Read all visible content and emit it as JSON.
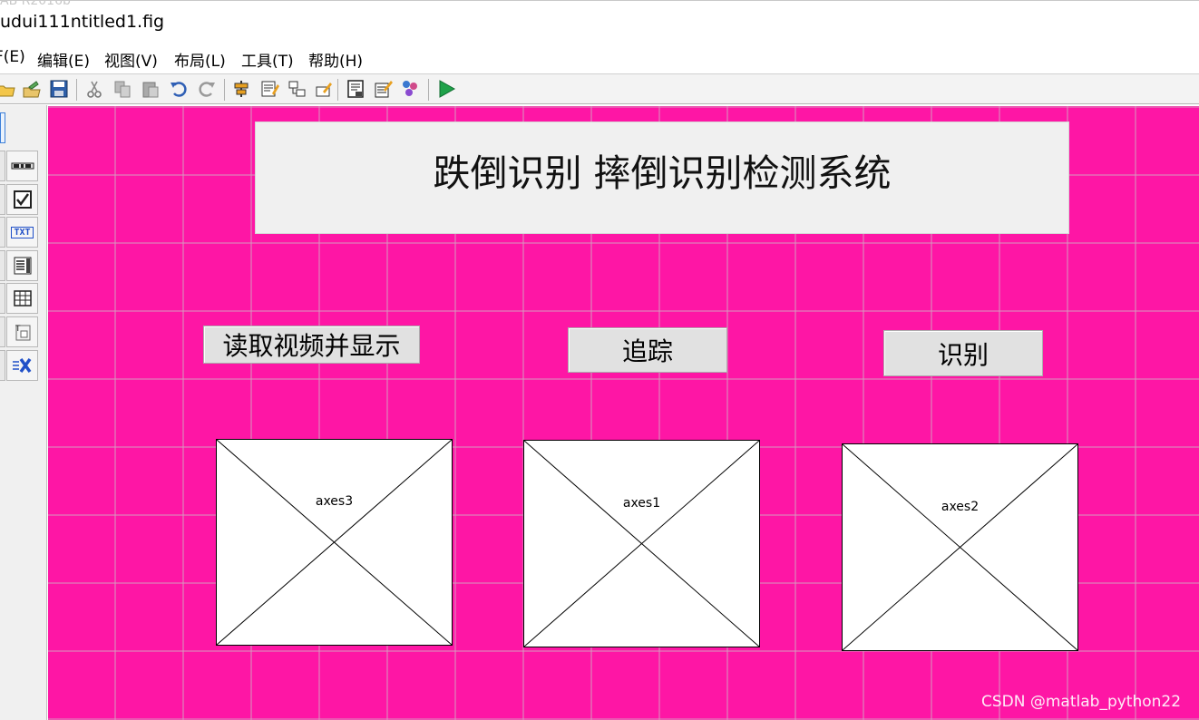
{
  "window": {
    "ghost_title": "AB R2016b",
    "title": "udui111ntitled1.fig"
  },
  "menu": [
    {
      "label": "F(E)"
    },
    {
      "label": "编辑(E)"
    },
    {
      "label": "视图(V)"
    },
    {
      "label": "布局(L)"
    },
    {
      "label": "工具(T)"
    },
    {
      "label": "帮助(H)"
    }
  ],
  "toolbar": {
    "icons": [
      "open-icon",
      "browse-icon",
      "save-icon",
      "cut-icon",
      "copy-icon",
      "paste-icon",
      "undo-icon",
      "redo-icon",
      "align-icon",
      "menu-editor-icon",
      "tab-order-icon",
      "toolbar-editor-icon",
      "editor-icon",
      "property-inspector-icon",
      "object-browser-icon",
      "run-icon"
    ]
  },
  "palette": {
    "items": [
      "pushbutton-icon",
      "slider-icon",
      "checkbox-icon",
      "edit-text-icon",
      "listbox-icon",
      "table-icon",
      "panel-icon",
      "activex-icon"
    ],
    "txt_label": "TXT"
  },
  "canvas": {
    "background": "#fe16a5",
    "title_text": "跌倒识别 摔倒识别检测系统",
    "buttons": {
      "read_video": "读取视频并显示",
      "track": "追踪",
      "identify": "识别"
    },
    "axes": {
      "axes3": "axes3",
      "axes1": "axes1",
      "axes2": "axes2"
    }
  },
  "watermark": "CSDN @matlab_python22"
}
